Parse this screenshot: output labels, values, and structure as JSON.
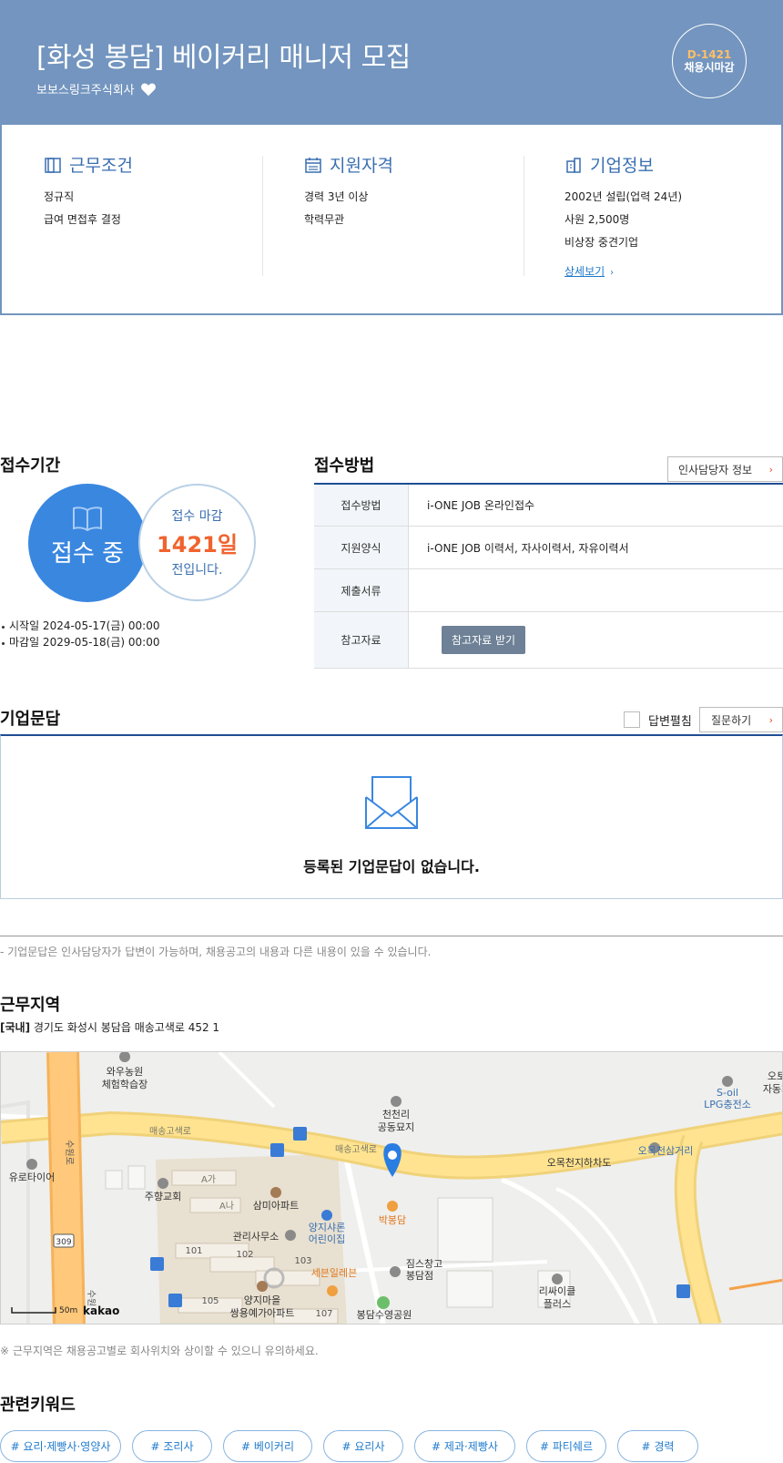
{
  "header": {
    "title": "[화성 봉담] 베이커리 매니저 모집",
    "company": "보보스링크주식회사",
    "dday_code": "D-1421",
    "dday_label": "채용시마감"
  },
  "info": {
    "work": {
      "title": "근무조건",
      "lines": [
        "정규직",
        "급여 면접후 결정"
      ]
    },
    "qual": {
      "title": "지원자격",
      "lines": [
        "경력 3년 이상",
        "학력무관"
      ]
    },
    "company": {
      "title": "기업정보",
      "lines": [
        "2002년 설립(업력 24년)",
        "사원 2,500명",
        "비상장 중견기업"
      ],
      "more": "상세보기"
    }
  },
  "period": {
    "title": "접수기간",
    "status": "접수 중",
    "deadline_a": "접수 마감",
    "deadline_days": "1421일",
    "deadline_c": "전입니다.",
    "start": "시작일 2024-05-17(금) 00:00",
    "end": "마감일 2029-05-18(금) 00:00"
  },
  "method": {
    "title": "접수방법",
    "hr_button": "인사담당자 정보",
    "rows": [
      {
        "k": "접수방법",
        "v": "i-ONE JOB 온라인접수"
      },
      {
        "k": "지원양식",
        "v": "i-ONE JOB 이력서, 자사이력서, 자유이력서"
      },
      {
        "k": "제출서류",
        "v": ""
      },
      {
        "k": "참고자료",
        "v": "참고자료 받기"
      }
    ]
  },
  "qa": {
    "title": "기업문답",
    "check_label": "답변펼침",
    "ask_button": "질문하기",
    "empty": "등록된 기업문답이 없습니다.",
    "note": "- 기업문답은 인사담당자가 답변이 가능하며, 채용공고의 내용과 다른 내용이 있을 수 있습니다."
  },
  "location": {
    "title": "근무지역",
    "region": "[국내]",
    "address": "경기도 화성시 봉담읍 매송고색로 452 1",
    "note": "※ 근무지역은 채용공고별로 회사위치와 상이할 수 있으니 유의하세요.",
    "map": {
      "labels": [
        "와우농원",
        "체험학습장",
        "천천리",
        "공동묘지",
        "매송고색로",
        "매송고색로",
        "오목천지하차도",
        "오목천삼거리",
        "S-oil",
        "LPG충전소",
        "오토",
        "자동차",
        "유로타이어",
        "주향교회",
        "A가",
        "A나",
        "삼미아파트",
        "관리사무소",
        "양지샤론",
        "어린이집",
        "박봉담",
        "101",
        "102",
        "103",
        "세븐일레븐",
        "짐스창고",
        "봉담점",
        "105",
        "양지마을",
        "쌍용예가아파트",
        "107",
        "봉담수영공원",
        "리싸이클",
        "플러스",
        "수원로",
        "309",
        "수원"
      ],
      "scale": "50m",
      "brand": "kakao"
    }
  },
  "keywords": {
    "title": "관련키워드",
    "items": [
      "# 요리·제빵사·영양사",
      "# 조리사",
      "# 베이커리",
      "# 요리사",
      "# 제과·제빵사",
      "# 파티쉐르",
      "# 경력"
    ]
  },
  "colors": {
    "header_bg": "#7395bf",
    "accent_blue": "#3a87e0",
    "accent_orange": "#f0632e",
    "navy": "#1e4e93"
  }
}
